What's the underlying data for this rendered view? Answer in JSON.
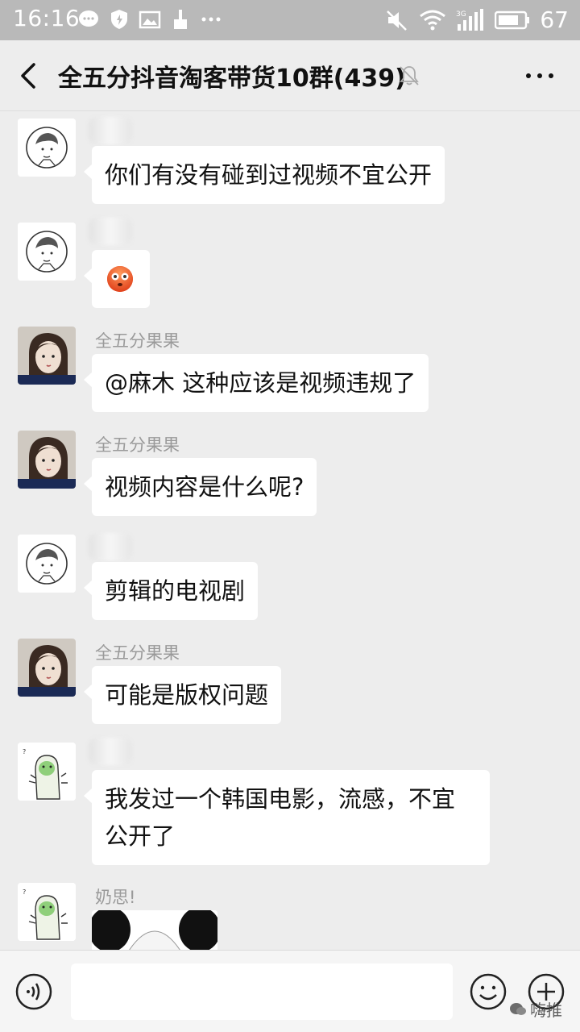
{
  "status_bar": {
    "time": "16:16",
    "battery": "67",
    "network": "3G"
  },
  "header": {
    "title": "全五分抖音淘客带货10群(439)"
  },
  "messages": [
    {
      "sender": "",
      "avatar": "sketch-avatar",
      "text": "你们有没有碰到过视频不宜公开"
    },
    {
      "sender": "",
      "avatar": "sketch-avatar",
      "text": "",
      "emoji": "flushed-face-emoji"
    },
    {
      "sender": "全五分果果",
      "avatar": "photo-avatar",
      "text": "@麻木 这种应该是视频违规了"
    },
    {
      "sender": "全五分果果",
      "avatar": "photo-avatar",
      "text": "视频内容是什么呢?"
    },
    {
      "sender": "",
      "avatar": "sketch-avatar",
      "text": "剪辑的电视剧"
    },
    {
      "sender": "全五分果果",
      "avatar": "photo-avatar",
      "text": "可能是版权问题"
    },
    {
      "sender": "",
      "avatar": "cartoon-avatar",
      "text_line1": "我发过一个韩国电影，流感，不宜",
      "text_line2": "公开了"
    },
    {
      "sender": "奶思!",
      "avatar": "cartoon-avatar",
      "image": "panda-sticker"
    }
  ],
  "input_bar": {
    "watermark": "嗨推"
  }
}
